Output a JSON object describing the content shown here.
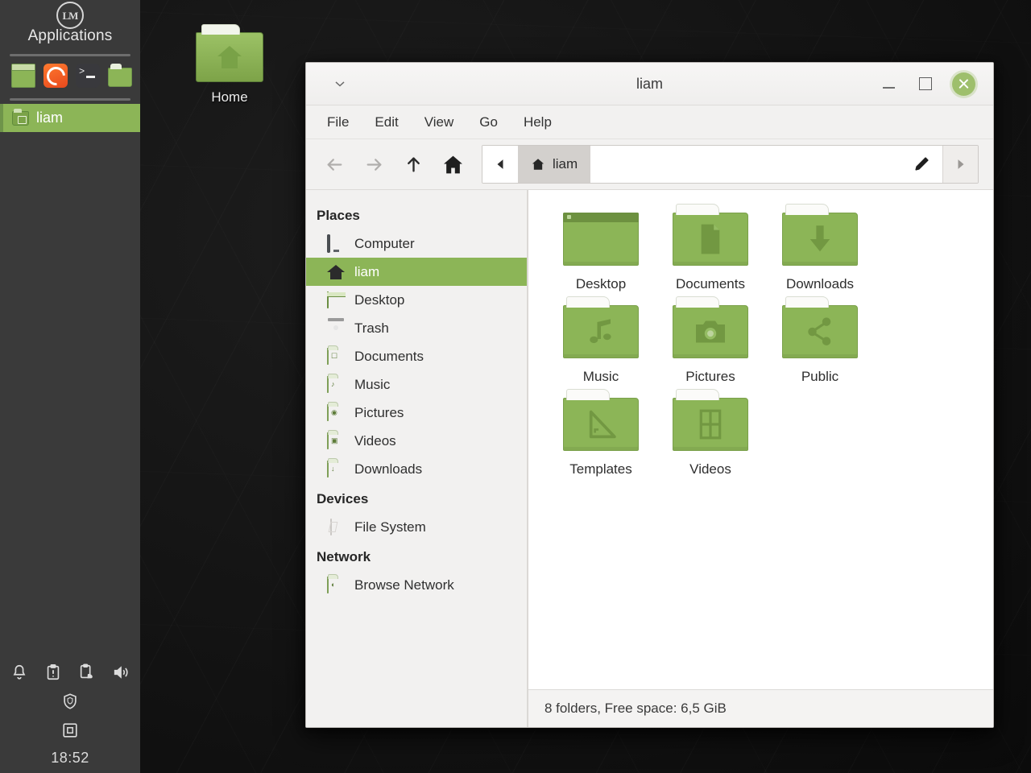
{
  "panel": {
    "menu_label": "Applications",
    "logo_text": "LM",
    "launchers": [
      {
        "name": "show-desktop",
        "title": "Show Desktop"
      },
      {
        "name": "firefox",
        "title": "Firefox Web Browser"
      },
      {
        "name": "terminal",
        "title": "Terminal"
      },
      {
        "name": "file-manager",
        "title": "Files"
      }
    ],
    "tasks": [
      {
        "label": "liam",
        "active": true
      }
    ],
    "tray": [
      {
        "name": "notifications-icon"
      },
      {
        "name": "update-manager-icon"
      },
      {
        "name": "clipboard-manager-icon"
      },
      {
        "name": "volume-icon"
      },
      {
        "name": "firewall-shield-icon"
      },
      {
        "name": "device-icon"
      }
    ],
    "clock": "18:52"
  },
  "desktop": {
    "icons": [
      {
        "label": "Home",
        "icon": "home-folder-icon"
      }
    ]
  },
  "window": {
    "title": "liam",
    "controls": {
      "minimize": "–",
      "maximize": "☐",
      "close": "×"
    },
    "menus": [
      "File",
      "Edit",
      "View",
      "Go",
      "Help"
    ],
    "toolbar": {
      "back": "Back",
      "forward": "Forward",
      "up": "Up",
      "home": "Home",
      "path_edit": "Edit path"
    },
    "pathbar": {
      "crumbs": [
        {
          "label": "liam",
          "icon": "home-icon",
          "active": true
        }
      ],
      "scroll_left": "◀",
      "scroll_right": "▶"
    },
    "sidebar": {
      "sections": [
        {
          "title": "Places",
          "items": [
            {
              "label": "Computer",
              "icon": "computer-icon",
              "selected": false
            },
            {
              "label": "liam",
              "icon": "home-icon",
              "selected": true
            },
            {
              "label": "Desktop",
              "icon": "desktop-icon",
              "selected": false
            },
            {
              "label": "Trash",
              "icon": "trash-icon",
              "selected": false
            },
            {
              "label": "Documents",
              "icon": "documents-folder-icon",
              "selected": false
            },
            {
              "label": "Music",
              "icon": "music-folder-icon",
              "selected": false
            },
            {
              "label": "Pictures",
              "icon": "pictures-folder-icon",
              "selected": false
            },
            {
              "label": "Videos",
              "icon": "videos-folder-icon",
              "selected": false
            },
            {
              "label": "Downloads",
              "icon": "downloads-folder-icon",
              "selected": false
            }
          ]
        },
        {
          "title": "Devices",
          "items": [
            {
              "label": "File System",
              "icon": "drive-icon",
              "selected": false
            }
          ]
        },
        {
          "title": "Network",
          "items": [
            {
              "label": "Browse Network",
              "icon": "network-folder-icon",
              "selected": false
            }
          ]
        }
      ]
    },
    "folders": [
      {
        "label": "Desktop",
        "icon": "desktop-folder-icon"
      },
      {
        "label": "Documents",
        "icon": "document-glyph"
      },
      {
        "label": "Downloads",
        "icon": "download-arrow-glyph"
      },
      {
        "label": "Music",
        "icon": "music-note-glyph"
      },
      {
        "label": "Pictures",
        "icon": "camera-glyph"
      },
      {
        "label": "Public",
        "icon": "share-glyph"
      },
      {
        "label": "Templates",
        "icon": "triangle-ruler-glyph"
      },
      {
        "label": "Videos",
        "icon": "film-glyph"
      }
    ],
    "statusbar": "8 folders, Free space: 6,5 GiB"
  },
  "colors": {
    "mint_green": "#8cb557",
    "panel_bg": "#3a3a3a",
    "window_bg": "#f2f1f0",
    "close_button": "#9ebf6c"
  }
}
